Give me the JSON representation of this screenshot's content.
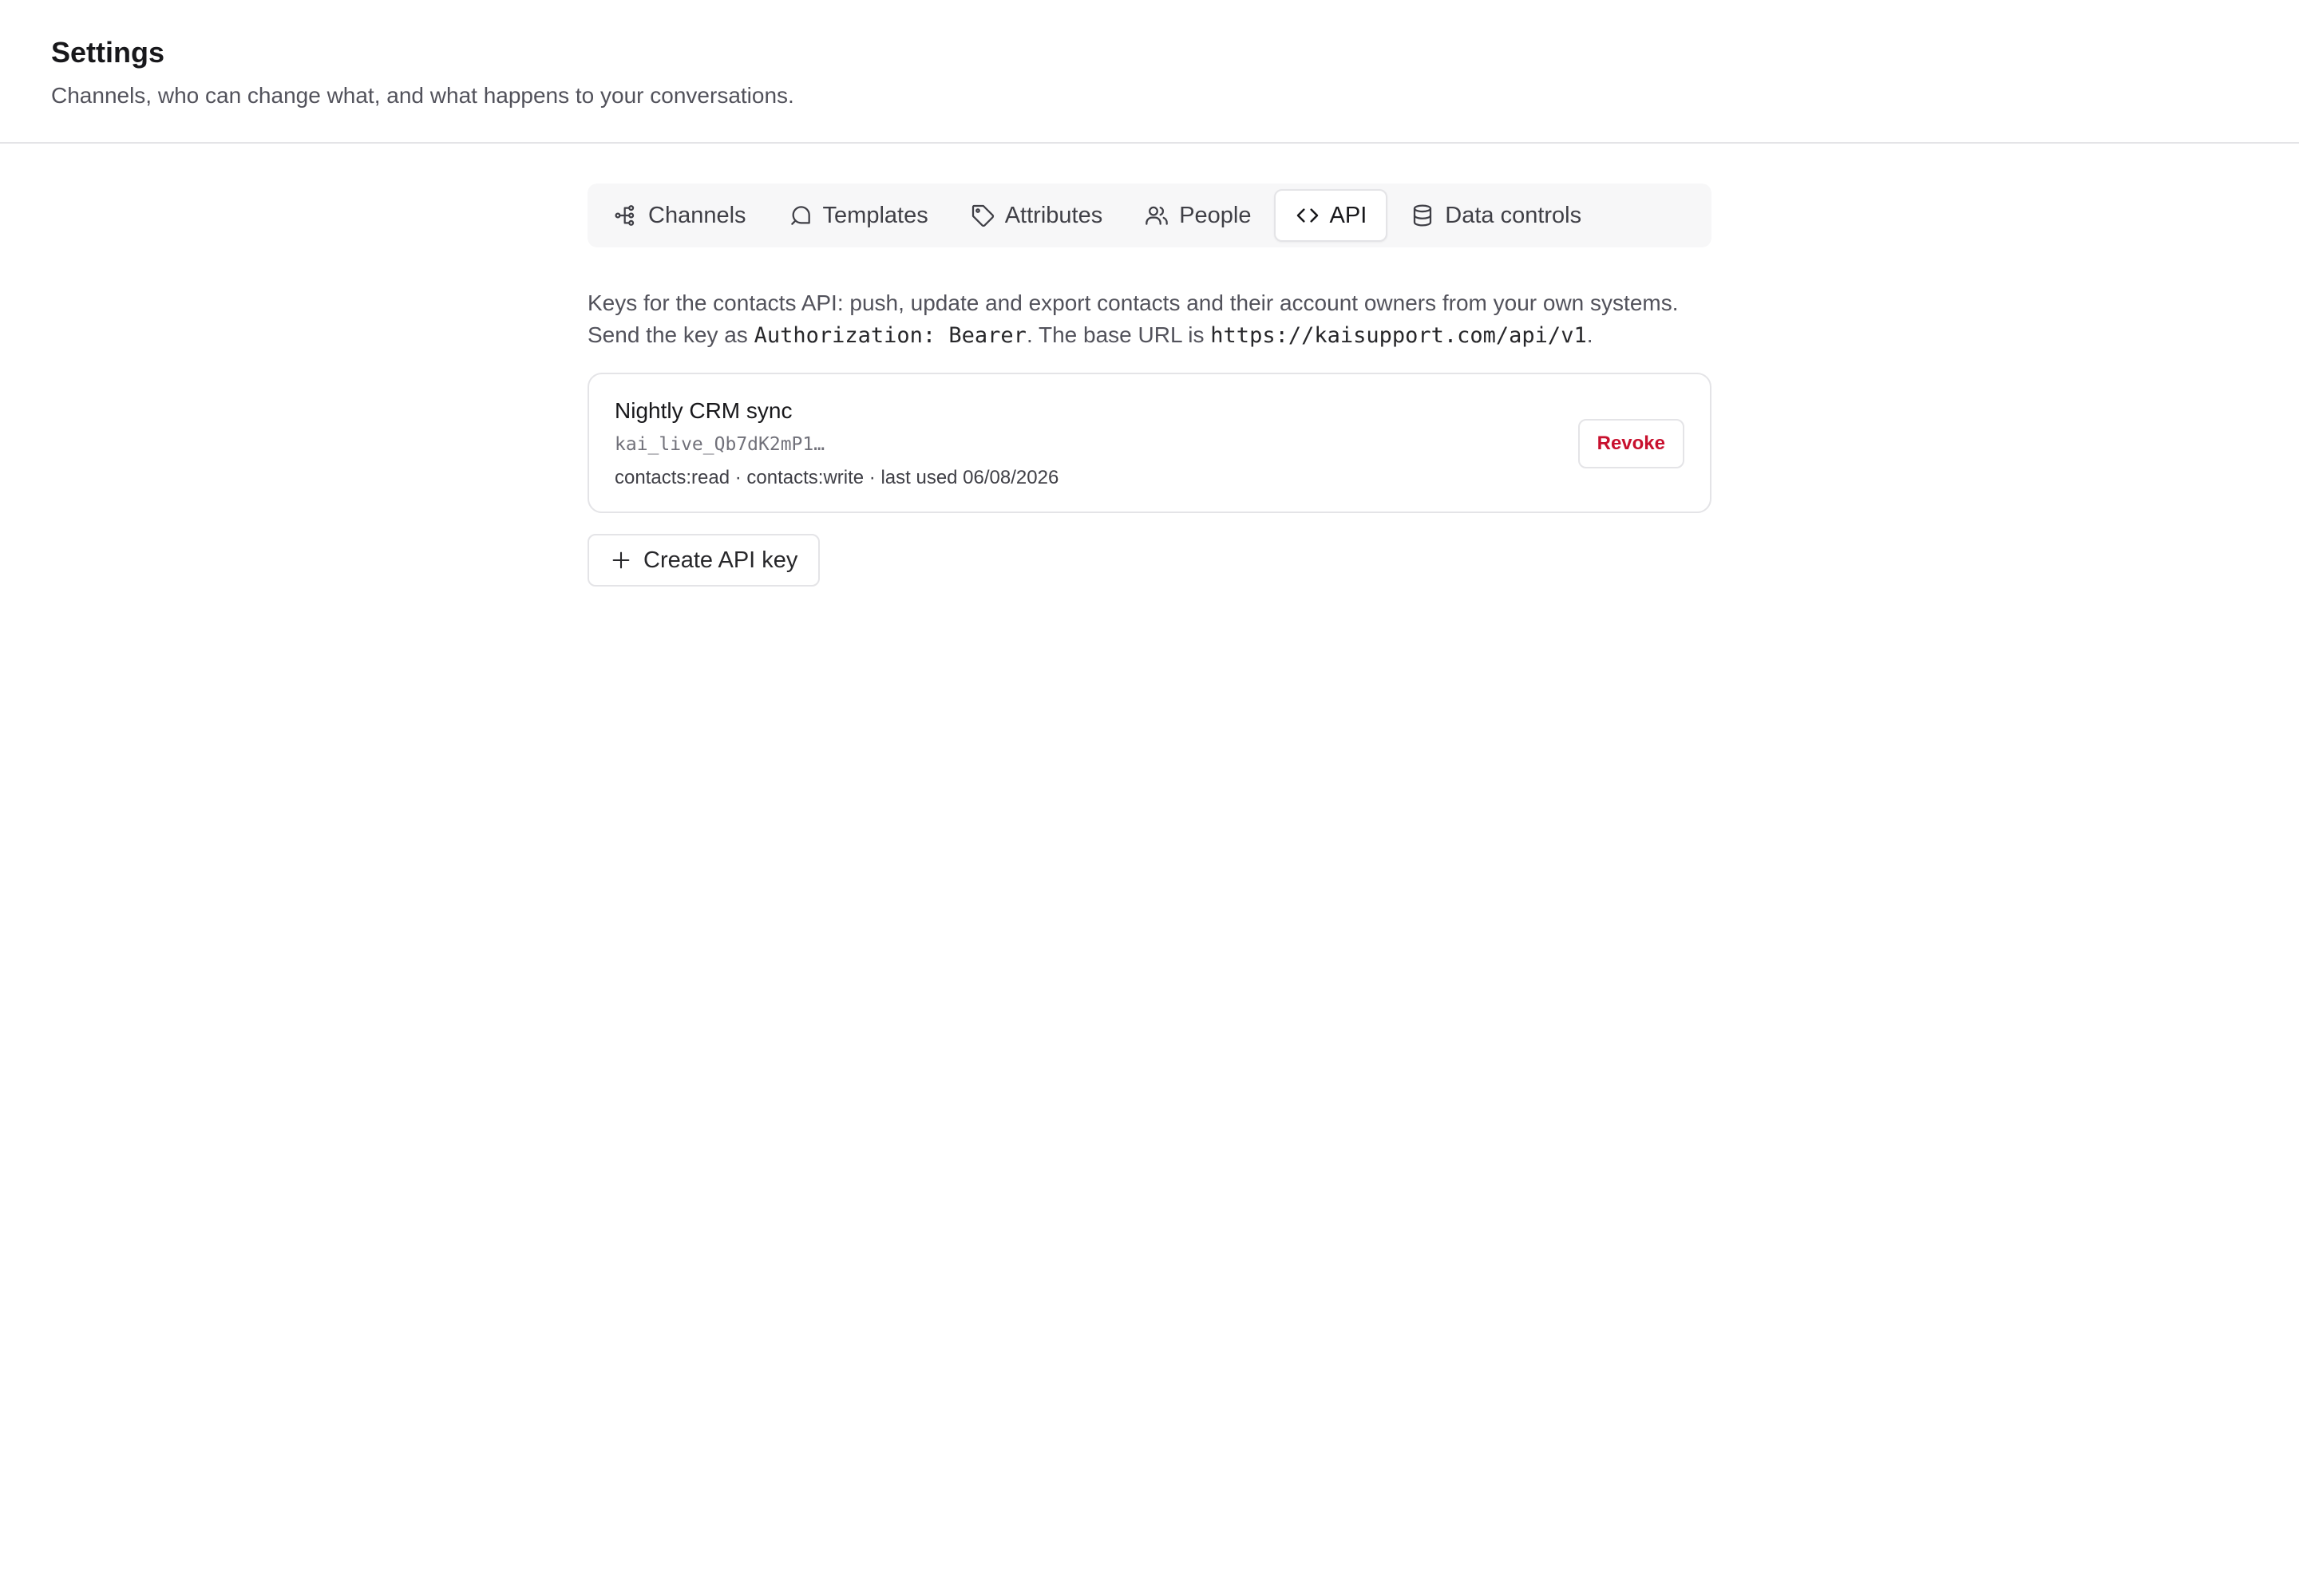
{
  "header": {
    "title": "Settings",
    "subtitle": "Channels, who can change what, and what happens to your conversations."
  },
  "tabs": [
    {
      "label": "Channels",
      "icon": "channels-icon",
      "active": false
    },
    {
      "label": "Templates",
      "icon": "templates-icon",
      "active": false
    },
    {
      "label": "Attributes",
      "icon": "tag-icon",
      "active": false
    },
    {
      "label": "People",
      "icon": "people-icon",
      "active": false
    },
    {
      "label": "API",
      "icon": "code-icon",
      "active": true
    },
    {
      "label": "Data controls",
      "icon": "database-icon",
      "active": false
    }
  ],
  "api": {
    "description_part1": "Keys for the contacts API: push, update and export contacts and their account owners from your own systems. Send the key as ",
    "auth_header": "Authorization: Bearer",
    "description_part2": ". The base URL is ",
    "base_url": "https://kaisupport.com/api/v1",
    "description_part3": ".",
    "keys": [
      {
        "name": "Nightly CRM sync",
        "prefix": "kai_live_Qb7dK2mP1…",
        "meta": "contacts:read · contacts:write · last used 06/08/2026",
        "revoke_label": "Revoke"
      }
    ],
    "create_label": "Create API key"
  },
  "colors": {
    "danger": "#c8102e",
    "border": "#e4e4e7",
    "tabbar_bg": "#f7f7f8"
  }
}
